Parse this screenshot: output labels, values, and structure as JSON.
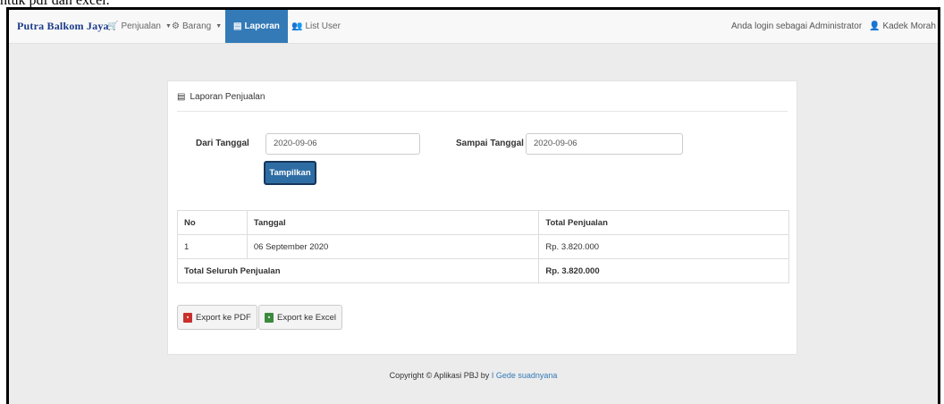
{
  "caption": "ntuk pdf dan excel.",
  "navbar": {
    "brand": "Putra Balkom Jaya",
    "items": [
      {
        "label": "Penjualan",
        "icon": "cart-icon",
        "dropdown": true
      },
      {
        "label": "Barang",
        "icon": "tag-icon",
        "dropdown": true
      },
      {
        "label": "Laporan",
        "icon": "file-icon",
        "active": true
      },
      {
        "label": "List User",
        "icon": "users-icon"
      }
    ],
    "login_text": "Anda login sebagai Administrator",
    "user_name": "Kadek Morah"
  },
  "panel": {
    "title": "Laporan Penjualan",
    "from_label": "Dari Tanggal",
    "from_value": "2020-09-06",
    "to_label": "Sampai Tanggal",
    "to_value": "2020-09-06",
    "show_button": "Tampilkan"
  },
  "table": {
    "headers": [
      "No",
      "Tanggal",
      "Total Penjualan"
    ],
    "rows": [
      [
        "1",
        "06 September 2020",
        "Rp. 3.820.000"
      ]
    ],
    "total_label": "Total Seluruh Penjualan",
    "total_value": "Rp. 3.820.000"
  },
  "export": {
    "pdf_label": "Export ke PDF",
    "excel_label": "Export ke Excel"
  },
  "footer": {
    "text": "Copyright © Aplikasi PBJ by ",
    "author": "I Gede suadnyana"
  },
  "colors": {
    "primary": "#337ab7",
    "background": "#ececec",
    "brand": "#1a3a8a"
  }
}
